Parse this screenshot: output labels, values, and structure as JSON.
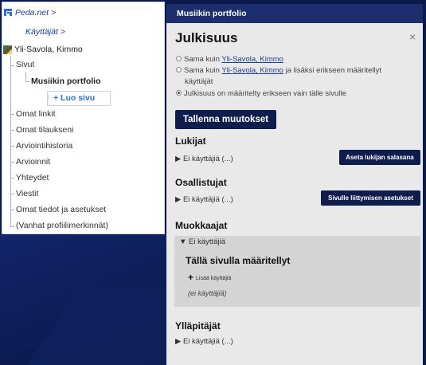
{
  "sidebar": {
    "pedanet": "Peda.net >",
    "kayttajat": "Käyttäjät >",
    "user_name": "Yli-Savola, Kimmo",
    "sivut": "Sivut",
    "current_page": "Musiikin portfolio",
    "create_page": "+ Luo sivu",
    "items": [
      "Omat linkit",
      "Omat tilaukseni",
      "Arviointihistoria",
      "Arvioinnit",
      "Yhteydet",
      "Viestit",
      "Omat tiedot ja asetukset",
      "(Vanhat profiilimerkinnät)"
    ]
  },
  "panel": {
    "header": "Musiikin portfolio",
    "title": "Julkisuus",
    "close": "×",
    "radio": {
      "opt1_prefix": "Sama kuin ",
      "opt1_link": "Yli-Savola, Kimmo",
      "opt2_prefix": "Sama kuin ",
      "opt2_link": "Yli-Savola, Kimmo",
      "opt2_suffix": " ja lisäksi erikseen määritellyt",
      "opt2_line2": "käyttäjät",
      "opt3": "Julkisuus on määritelty erikseen vain tälle sivulle"
    },
    "save_button": "Tallenna muutokset",
    "lukijat": {
      "title": "Lukijat",
      "toggle": "▶ Ei käyttäjiä (...)",
      "button": "Aseta lukijan salasana"
    },
    "osallistujat": {
      "title": "Osallistujat",
      "toggle": "▶ Ei käyttäjiä (...)",
      "button": "Sivulle liittymisen asetukset"
    },
    "muokkaajat": {
      "title": "Muokkaajat",
      "toggle": "▼ Ei käyttäjiä",
      "subtitle": "Tällä sivulla määritellyt",
      "add_icon": "+",
      "add_user": "Lisää käyttäjiä",
      "no_users": "(ei käyttäjiä)"
    },
    "yllapitajat": {
      "title": "Ylläpitäjät",
      "toggle": "▶ Ei käyttäjiä (...)"
    }
  }
}
